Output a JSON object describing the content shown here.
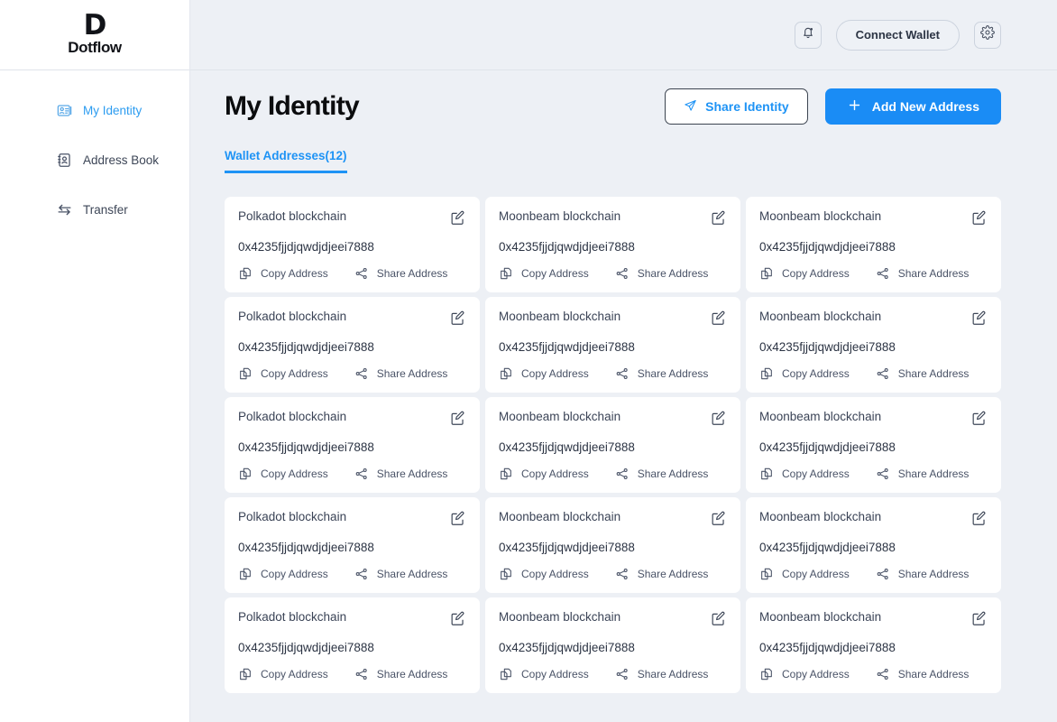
{
  "brand": {
    "mark": "D",
    "name": "Dotflow"
  },
  "sidebar": {
    "items": [
      {
        "label": "My Identity",
        "icon": "identity-card-icon",
        "active": true
      },
      {
        "label": "Address Book",
        "icon": "address-book-icon",
        "active": false
      },
      {
        "label": "Transfer",
        "icon": "transfer-arrows-icon",
        "active": false
      }
    ]
  },
  "topbar": {
    "notifications_icon": "bell-icon",
    "connect_label": "Connect Wallet",
    "settings_icon": "gear-icon"
  },
  "page": {
    "title": "My Identity",
    "share_label": "Share Identity",
    "share_icon": "paper-plane-icon",
    "add_label": "Add New Address",
    "add_icon": "plus-icon"
  },
  "tabs": [
    {
      "label": "Wallet Addresses(12)",
      "active": true
    }
  ],
  "card_labels": {
    "copy": "Copy Address",
    "share": "Share Address",
    "copy_icon": "copy-icon",
    "share_icon": "share-nodes-icon",
    "edit_icon": "edit-pencil-icon"
  },
  "colors": {
    "accent": "#1a8cf5",
    "link": "#1e93f5",
    "background": "#edf0f5",
    "card": "#ffffff",
    "text": "#2c3444",
    "muted": "#4a5367"
  },
  "cards": [
    {
      "chain": "Polkadot blockchain",
      "address": "0x4235fjjdjqwdjdjeei7888"
    },
    {
      "chain": "Moonbeam blockchain",
      "address": "0x4235fjjdjqwdjdjeei7888"
    },
    {
      "chain": "Moonbeam blockchain",
      "address": "0x4235fjjdjqwdjdjeei7888"
    },
    {
      "chain": "Polkadot blockchain",
      "address": "0x4235fjjdjqwdjdjeei7888"
    },
    {
      "chain": "Moonbeam blockchain",
      "address": "0x4235fjjdjqwdjdjeei7888"
    },
    {
      "chain": "Moonbeam blockchain",
      "address": "0x4235fjjdjqwdjdjeei7888"
    },
    {
      "chain": "Polkadot blockchain",
      "address": "0x4235fjjdjqwdjdjeei7888"
    },
    {
      "chain": "Moonbeam blockchain",
      "address": "0x4235fjjdjqwdjdjeei7888"
    },
    {
      "chain": "Moonbeam blockchain",
      "address": "0x4235fjjdjqwdjdjeei7888"
    },
    {
      "chain": "Polkadot blockchain",
      "address": "0x4235fjjdjqwdjdjeei7888"
    },
    {
      "chain": "Moonbeam blockchain",
      "address": "0x4235fjjdjqwdjdjeei7888"
    },
    {
      "chain": "Moonbeam blockchain",
      "address": "0x4235fjjdjqwdjdjeei7888"
    },
    {
      "chain": "Polkadot blockchain",
      "address": "0x4235fjjdjqwdjdjeei7888"
    },
    {
      "chain": "Moonbeam blockchain",
      "address": "0x4235fjjdjqwdjdjeei7888"
    },
    {
      "chain": "Moonbeam blockchain",
      "address": "0x4235fjjdjqwdjdjeei7888"
    }
  ]
}
